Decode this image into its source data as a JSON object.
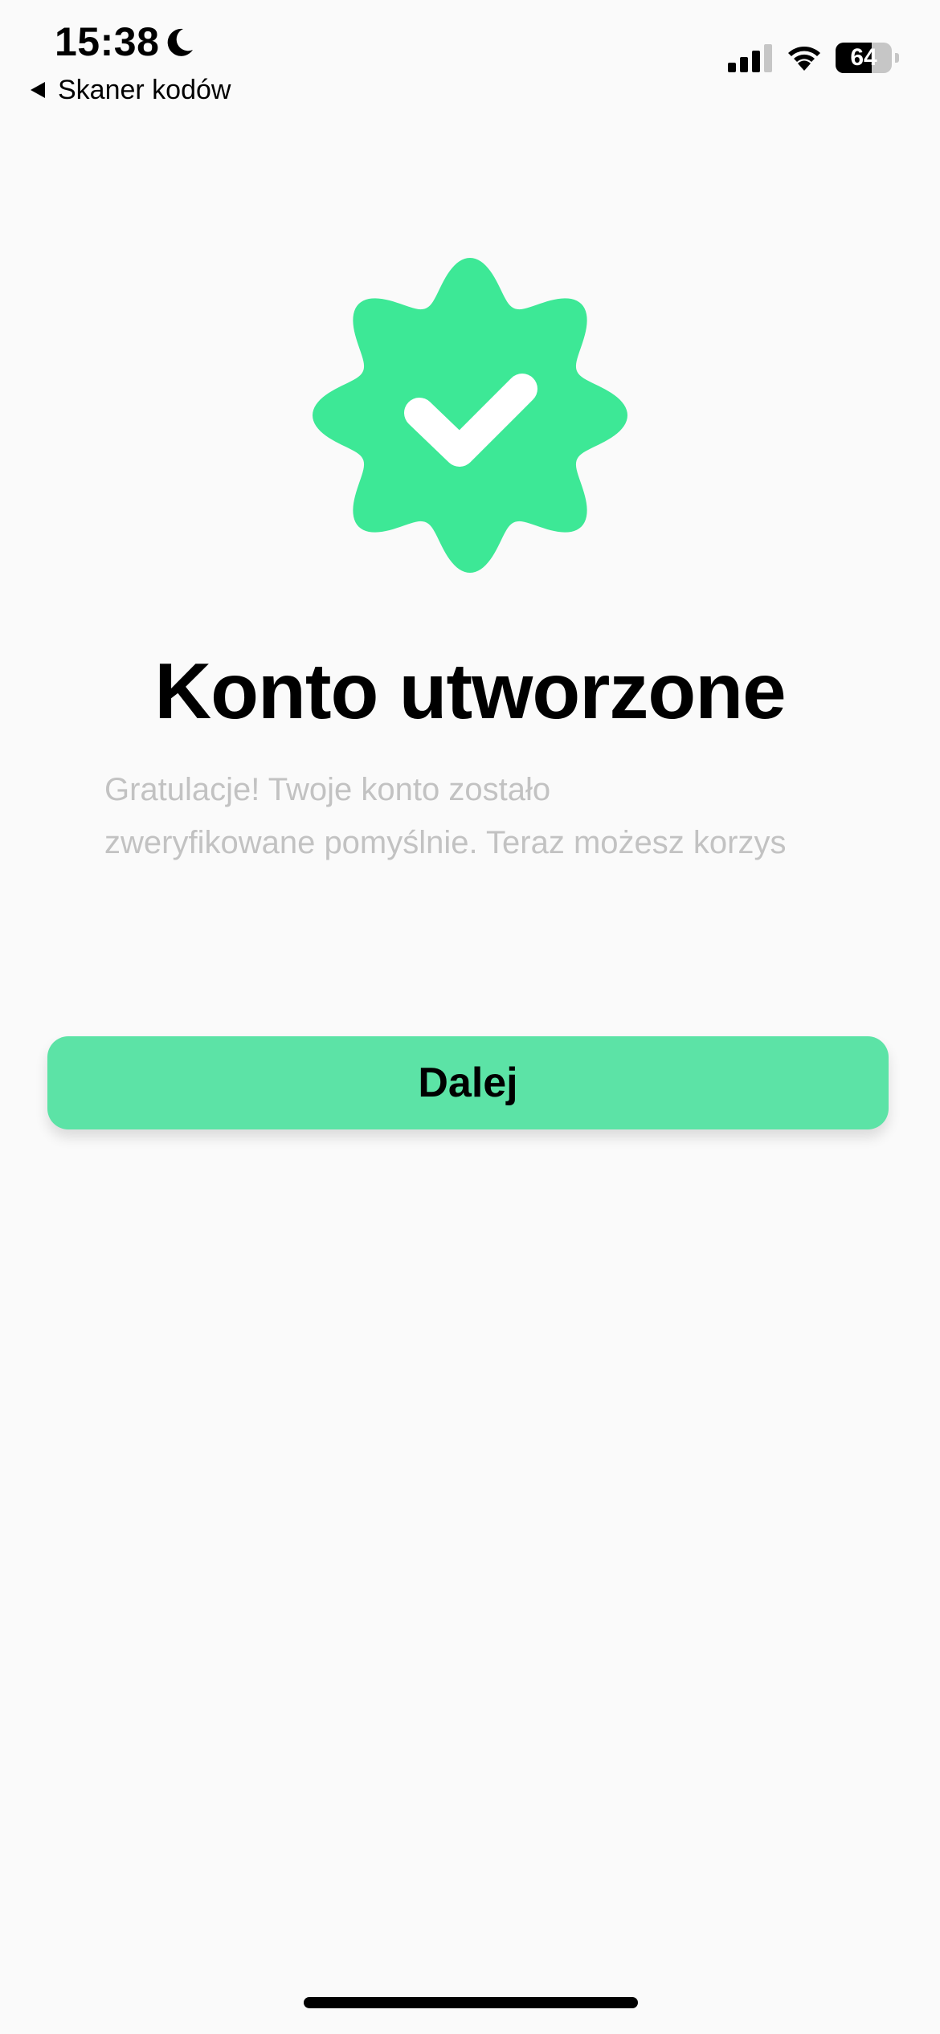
{
  "status_bar": {
    "time": "15:38",
    "back_label": "Skaner kodów",
    "battery_level": "64",
    "battery_fraction": 0.64
  },
  "icons": {
    "moon": "moon-icon",
    "back": "back-arrow-icon",
    "signal": "cellular-signal-icon",
    "wifi": "wifi-icon",
    "battery": "battery-icon",
    "badge": "verified-badge-icon"
  },
  "main": {
    "title": "Konto utworzone",
    "description_line1": "Gratulacje! Twoje konto zostało",
    "description_line2": "zweryfikowane pomyślnie. Teraz możesz korzys"
  },
  "actions": {
    "next_label": "Dalej"
  },
  "colors": {
    "badge_green": "#3de896",
    "button_green": "#5ce3a6",
    "background": "#fafafa",
    "description_gray": "#c2c2c2"
  }
}
